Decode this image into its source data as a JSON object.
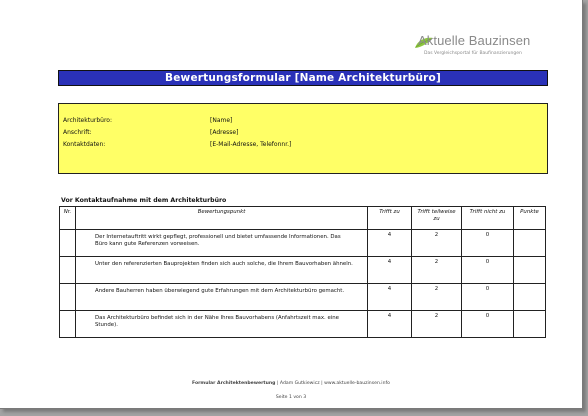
{
  "logo": {
    "name": "Aktuelle Bauzinsen",
    "tagline": "Das Vergleichsportal für Baufinanzierungen"
  },
  "title": "Bewertungsformular [Name Architekturbüro]",
  "info": [
    {
      "label": "Architekturbüro:",
      "value": "[Name]"
    },
    {
      "label": "Anschrift:",
      "value": "[Adresse]"
    },
    {
      "label": "Kontaktdaten:",
      "value": "[E-Mail-Adresse, Telefonnr.]"
    }
  ],
  "section_title": "Vor Kontaktaufnahme mit dem Architekturbüro",
  "table": {
    "headers": [
      "Nr.",
      "Bewertungspunkt",
      "Trifft zu",
      "Trifft teilweise zu",
      "Trifft nicht zu",
      "Punkte"
    ],
    "rows": [
      {
        "nr": "",
        "text": "Der Internetauftritt wirkt gepflegt, professionell und bietet umfassende Informationen. Das Büro kann gute Referenzen vorweisen.",
        "zu": "4",
        "teilweise": "2",
        "nicht": "0",
        "punkte": ""
      },
      {
        "nr": "",
        "text": "Unter den referenzierten Bauprojekten finden sich auch solche, die Ihrem Bauvorhaben ähneln.",
        "zu": "4",
        "teilweise": "2",
        "nicht": "0",
        "punkte": ""
      },
      {
        "nr": "",
        "text": "Andere Bauherren haben überwiegend gute Erfahrungen mit dem Architekturbüro gemacht.",
        "zu": "4",
        "teilweise": "2",
        "nicht": "0",
        "punkte": ""
      },
      {
        "nr": "",
        "text": "Das Architekturbüro befindet sich in der Nähe Ihres Bauvorhabens (Anfahrtszeit max. eine Stunde).",
        "zu": "4",
        "teilweise": "2",
        "nicht": "0",
        "punkte": ""
      }
    ]
  },
  "footer": {
    "doc": "Formular Architektenbewertung",
    "author": "| Adam Gutkiewicz",
    "site": "| www.aktuelle-bauzinsen.info",
    "page": "Seite 1 von 3"
  }
}
